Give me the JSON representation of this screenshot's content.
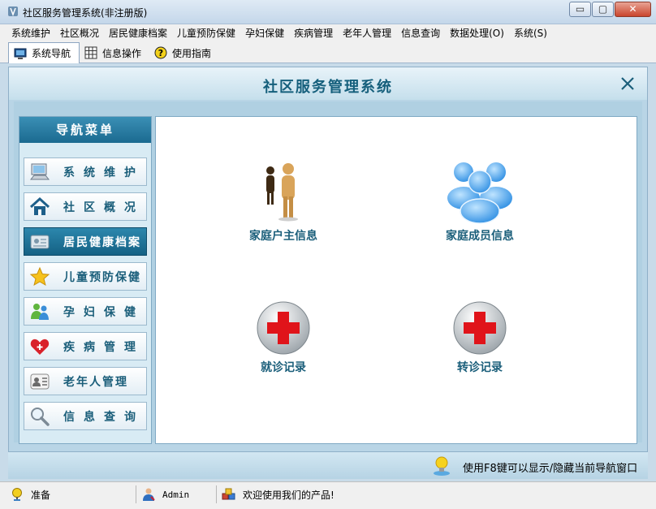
{
  "window": {
    "title": "社区服务管理系统(非注册版)",
    "buttons": {
      "minimize": "▭",
      "maximize": "▢",
      "close": "✕"
    }
  },
  "menubar": {
    "items": [
      "系统维护",
      "社区概况",
      "居民健康档案",
      "儿童预防保健",
      "孕妇保健",
      "疾病管理",
      "老年人管理",
      "信息查询",
      "数据处理(O)",
      "系统(S)"
    ]
  },
  "tabs": [
    {
      "label": "系统导航",
      "icon": "monitor-icon",
      "active": true
    },
    {
      "label": "信息操作",
      "icon": "grid-icon",
      "active": false
    },
    {
      "label": "使用指南",
      "icon": "help-icon",
      "active": false
    }
  ],
  "panel": {
    "title": "社区服务管理系统"
  },
  "nav": {
    "title": "导航菜单",
    "items": [
      {
        "label": "系统维护",
        "icon": "computer-icon",
        "active": false
      },
      {
        "label": "社区概况",
        "icon": "home-icon",
        "active": false
      },
      {
        "label": "居民健康档案",
        "icon": "id-card-icon",
        "active": true
      },
      {
        "label": "儿童预防保健",
        "icon": "star-icon",
        "active": false
      },
      {
        "label": "孕妇保健",
        "icon": "people-icon",
        "active": false
      },
      {
        "label": "疾病管理",
        "icon": "heart-plus-icon",
        "active": false
      },
      {
        "label": "老年人管理",
        "icon": "contact-card-icon",
        "active": false
      },
      {
        "label": "信息查询",
        "icon": "magnifier-icon",
        "active": false
      }
    ]
  },
  "content": {
    "tiles": [
      {
        "label": "家庭户主信息",
        "icon": "householder-icon"
      },
      {
        "label": "家庭成员信息",
        "icon": "family-members-icon"
      },
      {
        "label": "就诊记录",
        "icon": "red-cross-icon"
      },
      {
        "label": "转诊记录",
        "icon": "red-cross-icon"
      }
    ]
  },
  "hint": {
    "text": "使用F8键可以显示/隐藏当前导航窗口"
  },
  "status": {
    "state": "准备",
    "user": "Admin",
    "message": "欢迎使用我们的产品!"
  },
  "colors": {
    "accent": "#1a5e7a",
    "nav_active": "#146184",
    "red_cross": "#e0141a"
  }
}
